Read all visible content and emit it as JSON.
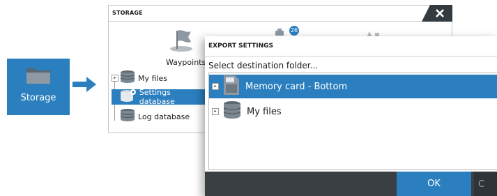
{
  "tile": {
    "label": "Storage",
    "icon": "folder-icon",
    "color": "#2b7fbf"
  },
  "storage_window": {
    "title": "STORAGE",
    "waypoints_label": "Waypoints",
    "badge_count": "26",
    "tree": [
      {
        "label": "My files",
        "icon": "database-icon",
        "selected": false
      },
      {
        "label": "Settings database",
        "icon": "database-gear-icon",
        "selected": true
      },
      {
        "label": "Log database",
        "icon": "database-icon",
        "selected": false
      }
    ]
  },
  "dialog": {
    "title": "EXPORT SETTINGS",
    "prompt": "Select destination folder...",
    "folders": [
      {
        "label": "Memory card - Bottom",
        "icon": "sd-card-icon",
        "selected": true
      },
      {
        "label": "My files",
        "icon": "database-icon",
        "selected": false
      }
    ],
    "ok_label": "OK",
    "cancel_label": "C"
  },
  "colors": {
    "accent": "#2b7fbf",
    "footer": "#3a3f44"
  }
}
